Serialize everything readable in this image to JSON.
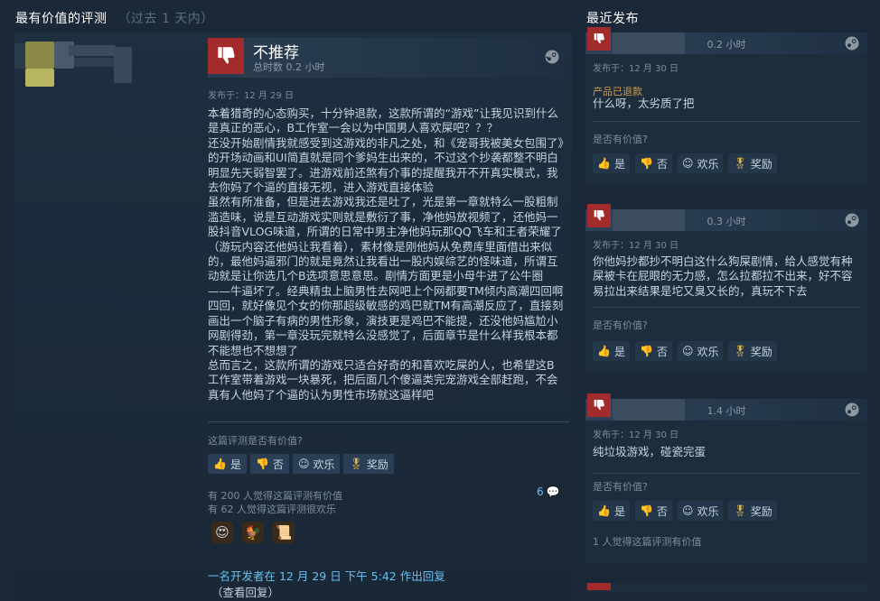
{
  "left": {
    "title": "最有价值的评测",
    "subtitle": "（过去 1 天内）",
    "review": {
      "verdict": "不推荐",
      "hours": "总时数 0.2 小时",
      "posted": "发布于：12 月 29 日",
      "body": "本着猎奇的心态购买，十分钟退款，这款所谓的“游戏”让我见识到什么是真正的恶心，B工作室一会以为中国男人喜欢屎吧？？？\n还没开始剧情我就感受到这游戏的非凡之处，和《宠哥我被美女包围了》的开场动画和UI简直就是同个爹妈生出来的，不过这个抄袭都整不明白明显先天弱智罢了。进游戏前还煞有介事的提醒我开不开真实模式，我去你妈了个逼的直接无视，进入游戏直接体验\n虽然有所准备，但是进去游戏我还是吐了，光是第一章就特么一股粗制滥造味，说是互动游戏实则就是敷衍了事，净他妈放视频了，还他妈一股抖音VLOG味道，所谓的日常中男主净他妈玩那QQ飞车和王者荣耀了（游玩内容还他妈让我看着），素材像是刚他妈从免费库里面借出来似的，最他妈逼邪门的就是竟然让我看出一股内娱综艺的怪味道，所谓互动就是让你选几个B选项意思意思。剧情方面更是小母牛进了公牛圈——牛逼坏了。经典精虫上脑男性去网吧上个网都要TM倾内高潮四回啊四回，就好像见个女的你那超级敏感的鸡巴就TM有高潮反应了，直接刻画出一个脑子有病的男性形象，演技更是鸡巴不能提，还没他妈尴尬小网剧得劲，第一章没玩完就特么没感觉了，后面章节是什么样我根本都不能想也不想想了\n总而言之，这款所谓的游戏只适合好奇的和喜欢吃屎的人，也希望这B工作室带着游戏一块暴死，把后面几个傻逼类完宠游戏全部赶跑，不会真有人他妈了个逼的认为男性市场就这逼样吧",
      "helpful_q": "这篇评测是否有价值?",
      "buttons": {
        "yes": "是",
        "no": "否",
        "funny": "欢乐",
        "award": "奖励"
      },
      "helpful_count": "有 200 人觉得这篇评测有价值",
      "funny_count": "有 62 人觉得这篇评测很欢乐",
      "comment_count": "6",
      "dev_reply": "一名开发者在 12 月 29 日 下午 5:42 作出回复",
      "dev_reply_link": "（查看回复）"
    }
  },
  "right": {
    "title": "最近发布",
    "items": [
      {
        "hours": "0.2 小时",
        "posted": "发布于：12 月 30 日",
        "refunded": "产品已退款",
        "text": "什么呀，太劣质了把",
        "helpful_q": "是否有价值?",
        "stat": ""
      },
      {
        "hours": "0.3 小时",
        "posted": "发布于：12 月 30 日",
        "refunded": "",
        "text": "你他妈抄都抄不明白这什么狗屎剧情，给人感觉有种屎被卡在屁眼的无力感，怎么拉都拉不出来，好不容易拉出来结果是坨又臭又长的，真玩不下去",
        "helpful_q": "是否有价值?",
        "stat": ""
      },
      {
        "hours": "1.4 小时",
        "posted": "发布于：12 月 30 日",
        "refunded": "",
        "text": "纯垃圾游戏，碰瓷完蛋",
        "helpful_q": "是否有价值?",
        "stat": "1 人觉得这篇评测有价值"
      }
    ],
    "buttons": {
      "yes": "是",
      "no": "否",
      "funny": "欢乐",
      "award": "奖励"
    }
  },
  "colors": {
    "background": "#1b2838",
    "accent_link": "#66c0f4",
    "not_recommended": "#a32b2b",
    "refunded": "#d39b42"
  }
}
